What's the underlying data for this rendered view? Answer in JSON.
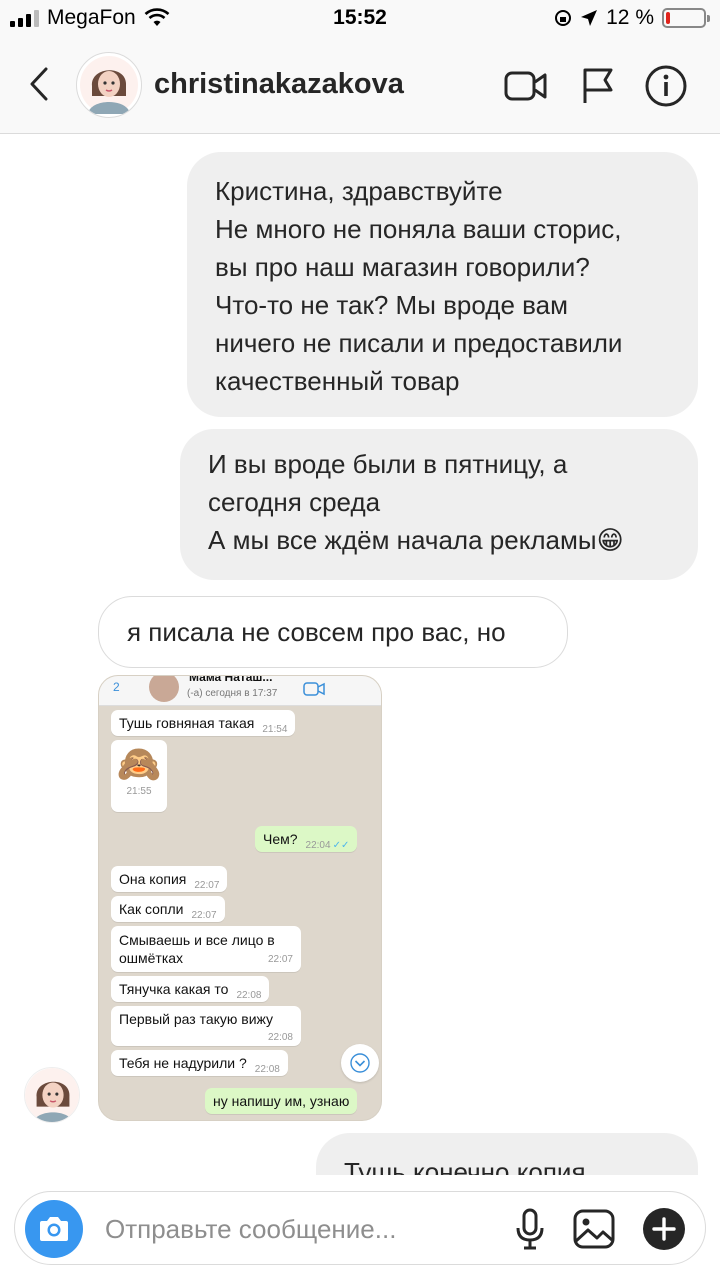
{
  "status_bar": {
    "carrier": "MegaFon",
    "time": "15:52",
    "battery_text": "12 %",
    "battery_level": 0.12,
    "battery_color": "#e0241c"
  },
  "header": {
    "username": "christinakazakova",
    "icons": [
      "chevron-left-icon",
      "video-camera-icon",
      "flag-icon",
      "info-icon"
    ]
  },
  "messages": [
    {
      "direction": "outgoing",
      "lines": [
        "Кристина, здравствуйте",
        "Не много не поняла ваши сторис,",
        "вы про наш магазин говорили?",
        "Что-то не так? Мы вроде вам",
        "ничего не писали и предоставили",
        "качественный товар"
      ]
    },
    {
      "direction": "outgoing",
      "lines": [
        "И вы вроде были в пятницу, а",
        "сегодня среда",
        "А мы все ждём начала рекламы😁"
      ]
    },
    {
      "direction": "incoming",
      "lines": [
        "я писала не совсем про вас, но"
      ]
    },
    {
      "direction": "outgoing",
      "lines": [
        "Тушь конечно копия"
      ]
    }
  ],
  "shared_screenshot": {
    "header_back": "2",
    "header_title": "Мама Наташ...",
    "header_status": "(-а) сегодня в 17:37",
    "sticker": "🙈",
    "sticker_time": "21:55",
    "bubbles": [
      {
        "text": "Тушь говняная такая",
        "time": "21:54",
        "dir": "in"
      },
      {
        "text": "Чем?",
        "time": "22:04",
        "dir": "out"
      },
      {
        "text": "Она копия",
        "time": "22:07",
        "dir": "in"
      },
      {
        "text": "Как сопли",
        "time": "22:07",
        "dir": "in"
      },
      {
        "text": "Смываешь и все лицо в",
        "text2": "ошмётках",
        "time": "22:07",
        "dir": "in"
      },
      {
        "text": "Тянучка какая то",
        "time": "22:08",
        "dir": "in"
      },
      {
        "text": "Первый раз такую вижу",
        "time": "22:08",
        "dir": "in"
      },
      {
        "text": "Тебя не надурили ?",
        "time": "22:08",
        "dir": "in"
      },
      {
        "text": "ну напишу им, узнаю",
        "time": "",
        "dir": "out"
      }
    ]
  },
  "composer": {
    "placeholder": "Отправьте сообщение...",
    "icons": [
      "camera-icon",
      "microphone-icon",
      "gallery-icon",
      "plus-icon"
    ]
  },
  "colors": {
    "outgoing_bubble": "#efefef",
    "incoming_border": "#dbdbdb",
    "camera_button": "#3897f0",
    "whatsapp_out": "#dcf8c6"
  }
}
